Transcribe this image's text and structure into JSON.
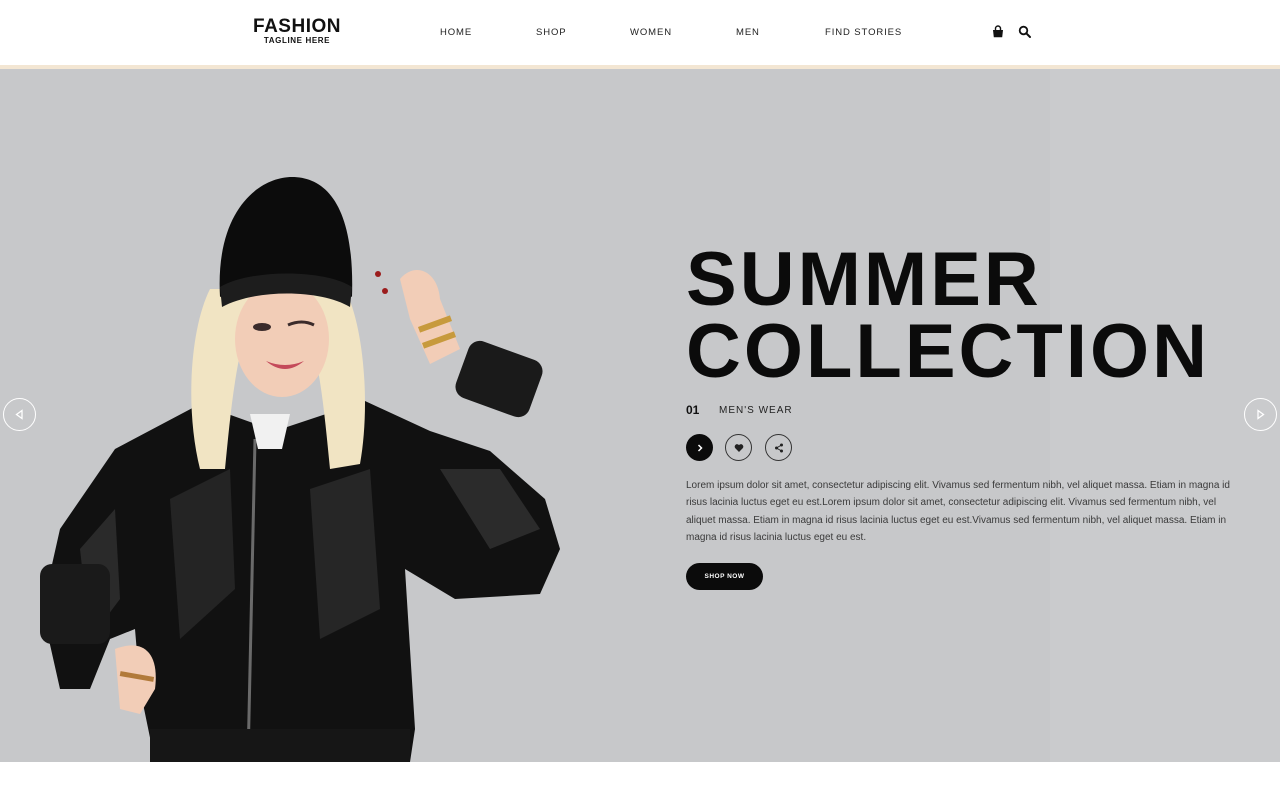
{
  "header": {
    "logo_title": "FASHION",
    "logo_tagline": "TAGLINE HERE",
    "nav": [
      "HOME",
      "SHOP",
      "WOMEN",
      "MEN",
      "FIND STORIES"
    ],
    "icons": [
      "shopping-bag-icon",
      "search-icon"
    ],
    "border_color": "#f3e6d3"
  },
  "hero": {
    "background_color": "#c7c8ca",
    "title_line1": "SUMMER",
    "title_line2": "COLLECTION",
    "slide_number": "01",
    "slide_category": "MEN'S WEAR",
    "action_icons": [
      "chevron-right-icon",
      "heart-icon",
      "share-icon"
    ],
    "description": "Lorem ipsum dolor sit amet, consectetur adipiscing elit. Vivamus sed fermentum nibh, vel aliquet massa. Etiam in magna id risus lacinia luctus eget eu est.Lorem ipsum dolor sit amet, consectetur adipiscing elit. Vivamus sed fermentum nibh, vel aliquet massa. Etiam in magna id risus lacinia luctus eget eu est.Vivamus sed fermentum nibh, vel aliquet massa. Etiam in magna id risus lacinia luctus eget eu est.",
    "cta_label": "SHOP NOW",
    "slider_icons": [
      "previous-slide-icon",
      "next-slide-icon"
    ]
  }
}
